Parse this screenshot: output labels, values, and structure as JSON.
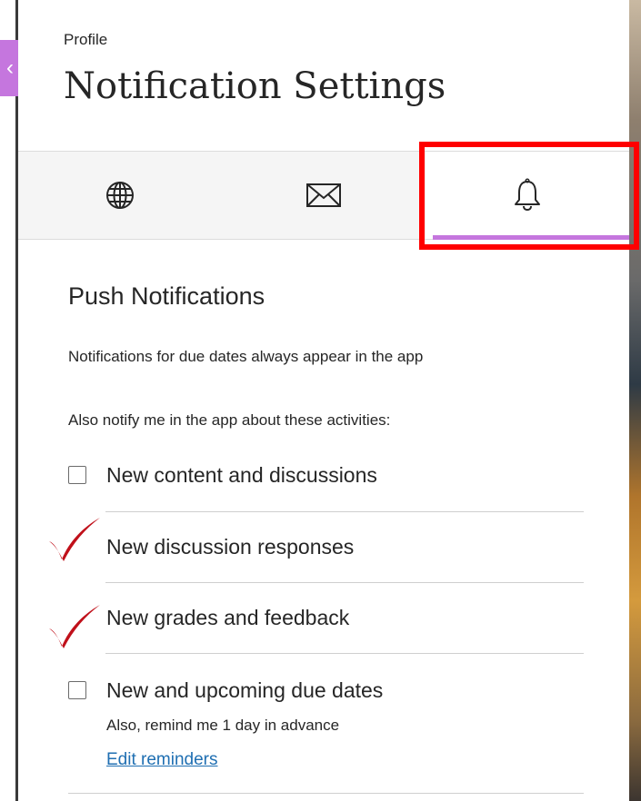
{
  "header": {
    "breadcrumb": "Profile",
    "title": "Notification Settings"
  },
  "tabs": [
    {
      "icon": "globe-icon",
      "glyph": "🌐",
      "active": false
    },
    {
      "icon": "envelope-icon",
      "glyph": "✉",
      "active": false
    },
    {
      "icon": "bell-icon",
      "glyph": "🔔",
      "active": true
    }
  ],
  "accent_color": "#c576de",
  "highlight_color": "#ff0000",
  "section": {
    "heading": "Push Notifications",
    "note": "Notifications for due dates always appear in the app",
    "subhead": "Also notify me in the app about these activities:"
  },
  "options": [
    {
      "label": "New content and discussions",
      "checked": false
    },
    {
      "label": "New discussion responses",
      "checked": true
    },
    {
      "label": "New grades and feedback",
      "checked": true
    },
    {
      "label": "New and upcoming due dates",
      "checked": false
    }
  ],
  "reminder": {
    "hint": "Also, remind me 1 day in advance",
    "link": "Edit reminders"
  }
}
